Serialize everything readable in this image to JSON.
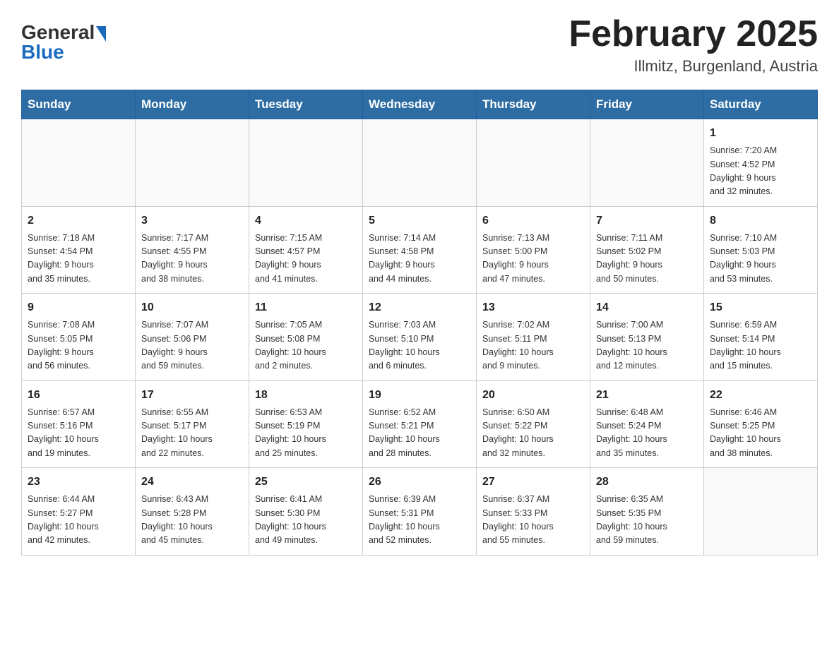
{
  "header": {
    "logo_general": "General",
    "logo_blue": "Blue",
    "month_title": "February 2025",
    "location": "Illmitz, Burgenland, Austria"
  },
  "days_of_week": [
    "Sunday",
    "Monday",
    "Tuesday",
    "Wednesday",
    "Thursday",
    "Friday",
    "Saturday"
  ],
  "weeks": [
    {
      "days": [
        {
          "num": "",
          "info": ""
        },
        {
          "num": "",
          "info": ""
        },
        {
          "num": "",
          "info": ""
        },
        {
          "num": "",
          "info": ""
        },
        {
          "num": "",
          "info": ""
        },
        {
          "num": "",
          "info": ""
        },
        {
          "num": "1",
          "info": "Sunrise: 7:20 AM\nSunset: 4:52 PM\nDaylight: 9 hours\nand 32 minutes."
        }
      ]
    },
    {
      "days": [
        {
          "num": "2",
          "info": "Sunrise: 7:18 AM\nSunset: 4:54 PM\nDaylight: 9 hours\nand 35 minutes."
        },
        {
          "num": "3",
          "info": "Sunrise: 7:17 AM\nSunset: 4:55 PM\nDaylight: 9 hours\nand 38 minutes."
        },
        {
          "num": "4",
          "info": "Sunrise: 7:15 AM\nSunset: 4:57 PM\nDaylight: 9 hours\nand 41 minutes."
        },
        {
          "num": "5",
          "info": "Sunrise: 7:14 AM\nSunset: 4:58 PM\nDaylight: 9 hours\nand 44 minutes."
        },
        {
          "num": "6",
          "info": "Sunrise: 7:13 AM\nSunset: 5:00 PM\nDaylight: 9 hours\nand 47 minutes."
        },
        {
          "num": "7",
          "info": "Sunrise: 7:11 AM\nSunset: 5:02 PM\nDaylight: 9 hours\nand 50 minutes."
        },
        {
          "num": "8",
          "info": "Sunrise: 7:10 AM\nSunset: 5:03 PM\nDaylight: 9 hours\nand 53 minutes."
        }
      ]
    },
    {
      "days": [
        {
          "num": "9",
          "info": "Sunrise: 7:08 AM\nSunset: 5:05 PM\nDaylight: 9 hours\nand 56 minutes."
        },
        {
          "num": "10",
          "info": "Sunrise: 7:07 AM\nSunset: 5:06 PM\nDaylight: 9 hours\nand 59 minutes."
        },
        {
          "num": "11",
          "info": "Sunrise: 7:05 AM\nSunset: 5:08 PM\nDaylight: 10 hours\nand 2 minutes."
        },
        {
          "num": "12",
          "info": "Sunrise: 7:03 AM\nSunset: 5:10 PM\nDaylight: 10 hours\nand 6 minutes."
        },
        {
          "num": "13",
          "info": "Sunrise: 7:02 AM\nSunset: 5:11 PM\nDaylight: 10 hours\nand 9 minutes."
        },
        {
          "num": "14",
          "info": "Sunrise: 7:00 AM\nSunset: 5:13 PM\nDaylight: 10 hours\nand 12 minutes."
        },
        {
          "num": "15",
          "info": "Sunrise: 6:59 AM\nSunset: 5:14 PM\nDaylight: 10 hours\nand 15 minutes."
        }
      ]
    },
    {
      "days": [
        {
          "num": "16",
          "info": "Sunrise: 6:57 AM\nSunset: 5:16 PM\nDaylight: 10 hours\nand 19 minutes."
        },
        {
          "num": "17",
          "info": "Sunrise: 6:55 AM\nSunset: 5:17 PM\nDaylight: 10 hours\nand 22 minutes."
        },
        {
          "num": "18",
          "info": "Sunrise: 6:53 AM\nSunset: 5:19 PM\nDaylight: 10 hours\nand 25 minutes."
        },
        {
          "num": "19",
          "info": "Sunrise: 6:52 AM\nSunset: 5:21 PM\nDaylight: 10 hours\nand 28 minutes."
        },
        {
          "num": "20",
          "info": "Sunrise: 6:50 AM\nSunset: 5:22 PM\nDaylight: 10 hours\nand 32 minutes."
        },
        {
          "num": "21",
          "info": "Sunrise: 6:48 AM\nSunset: 5:24 PM\nDaylight: 10 hours\nand 35 minutes."
        },
        {
          "num": "22",
          "info": "Sunrise: 6:46 AM\nSunset: 5:25 PM\nDaylight: 10 hours\nand 38 minutes."
        }
      ]
    },
    {
      "days": [
        {
          "num": "23",
          "info": "Sunrise: 6:44 AM\nSunset: 5:27 PM\nDaylight: 10 hours\nand 42 minutes."
        },
        {
          "num": "24",
          "info": "Sunrise: 6:43 AM\nSunset: 5:28 PM\nDaylight: 10 hours\nand 45 minutes."
        },
        {
          "num": "25",
          "info": "Sunrise: 6:41 AM\nSunset: 5:30 PM\nDaylight: 10 hours\nand 49 minutes."
        },
        {
          "num": "26",
          "info": "Sunrise: 6:39 AM\nSunset: 5:31 PM\nDaylight: 10 hours\nand 52 minutes."
        },
        {
          "num": "27",
          "info": "Sunrise: 6:37 AM\nSunset: 5:33 PM\nDaylight: 10 hours\nand 55 minutes."
        },
        {
          "num": "28",
          "info": "Sunrise: 6:35 AM\nSunset: 5:35 PM\nDaylight: 10 hours\nand 59 minutes."
        },
        {
          "num": "",
          "info": ""
        }
      ]
    }
  ]
}
